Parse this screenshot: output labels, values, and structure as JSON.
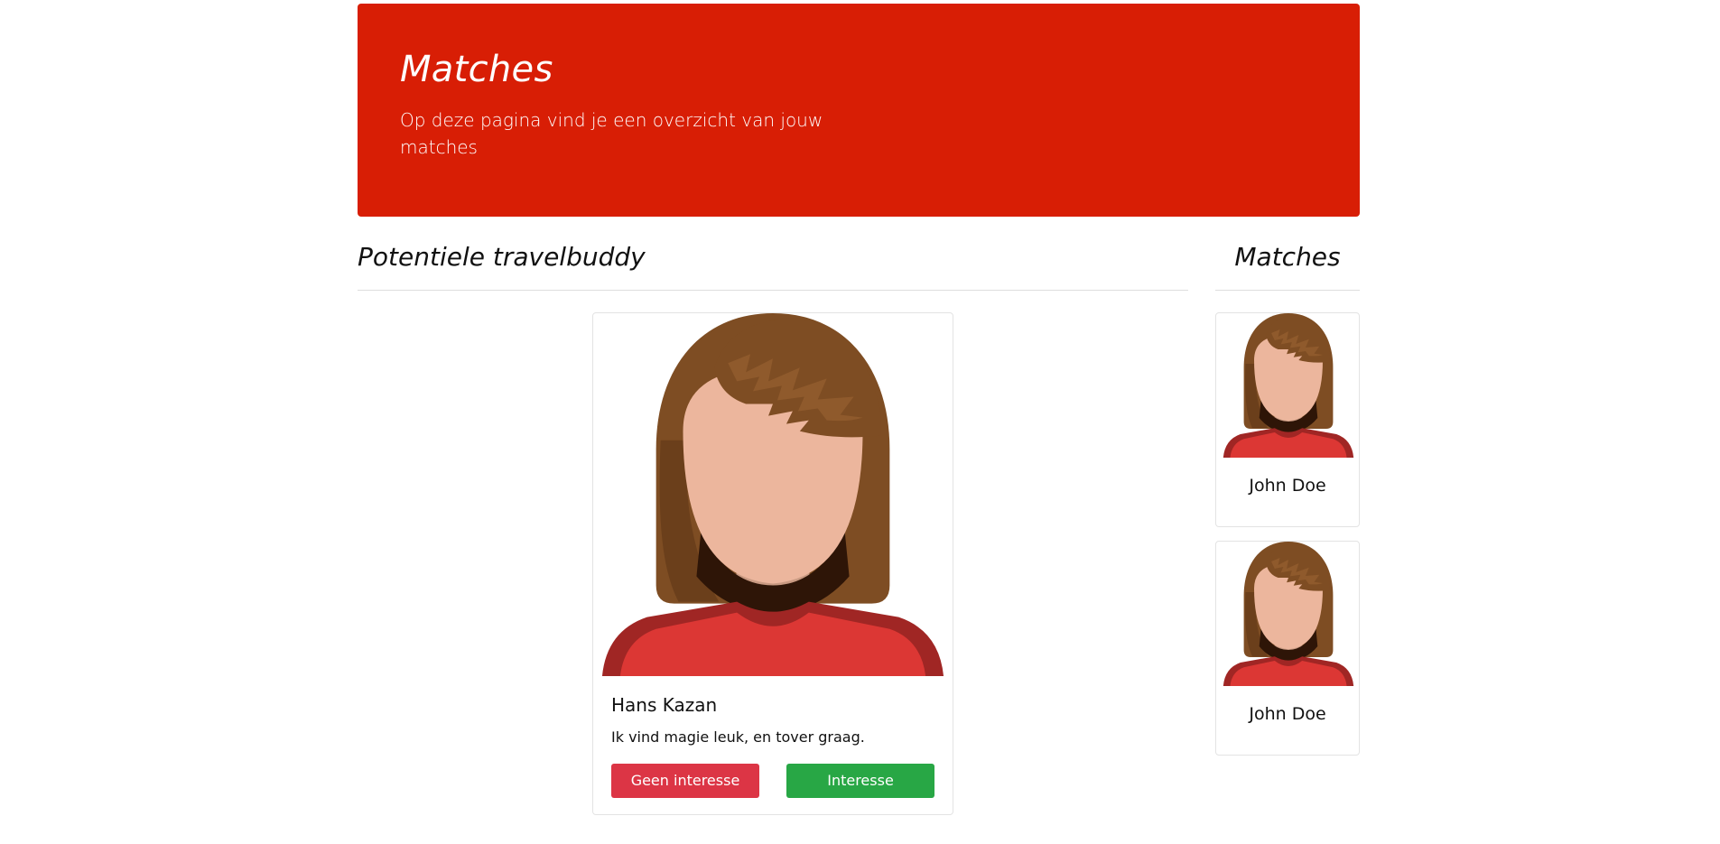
{
  "hero": {
    "title": "Matches",
    "subtitle": "Op deze pagina vind je een overzicht van jouw matches",
    "color": "#d81e05"
  },
  "buddy_section": {
    "title": "Potentiele travelbuddy",
    "card": {
      "name": "Hans Kazan",
      "description": "Ik vind magie leuk, en tover graag.",
      "avatar_icon": "female-avatar-icon",
      "reject_label": "Geen interesse",
      "accept_label": "Interesse"
    }
  },
  "matches_section": {
    "title": "Matches",
    "items": [
      {
        "name": "John Doe",
        "avatar_icon": "female-avatar-icon"
      },
      {
        "name": "John Doe",
        "avatar_icon": "female-avatar-icon"
      }
    ]
  },
  "colors": {
    "reject": "#dc3545",
    "accept": "#28a745"
  }
}
